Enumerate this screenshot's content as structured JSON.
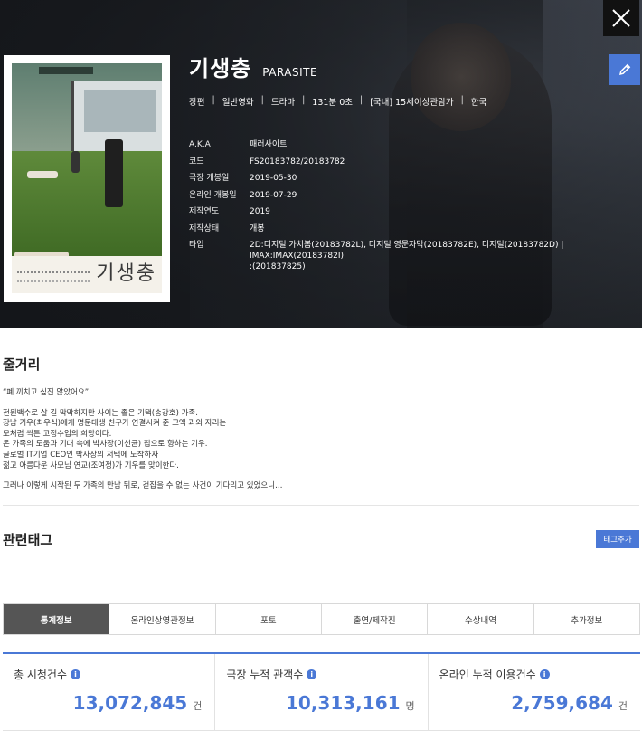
{
  "movie": {
    "title_ko": "기생충",
    "title_en": "PARASITE",
    "meta": [
      "장편",
      "일반영화",
      "드라마",
      "131분 0초",
      "[국내] 15세이상관람가",
      "한국"
    ],
    "specs": [
      {
        "key": "A.K.A",
        "value": "패러사이트"
      },
      {
        "key": "코드",
        "value": "FS20183782/20183782"
      },
      {
        "key": "극장 개봉일",
        "value": "2019-05-30"
      },
      {
        "key": "온라인 개봉일",
        "value": "2019-07-29"
      },
      {
        "key": "제작연도",
        "value": "2019"
      },
      {
        "key": "제작상태",
        "value": "개봉"
      },
      {
        "key": "타입",
        "value": "2D:디지털 가치봄(20183782L), 디지털 영문자막(20183782E), 디지털(20183782D)  |  IMAX:IMAX(20183782I)\n:(201837825)"
      }
    ],
    "poster_title": "기생충"
  },
  "synopsis": {
    "title": "줄거리",
    "paragraphs": [
      "“폐 끼치고 싶진 않았어요”",
      "전원백수로 살 길 막막하지만 사이는 좋은 기택(송강호) 가족.\n장남 기우(최우식)에게 명문대생 친구가 연결시켜 준 고액 과외 자리는\n모처럼 싹튼 고정수입의 희망이다.\n온 가족의 도움과 기대 속에 박사장(이선균) 집으로 향하는 기우.\n글로벌 IT기업 CEO인 박사장의 저택에 도착하자\n젊고 아름다운 사모님 연교(조여정)가 기우를 맞이한다.",
      "그러나 이렇게 시작된 두 가족의 만남 뒤로, 걷잡을 수 없는 사건이 기다리고 있었으니…"
    ]
  },
  "tags": {
    "title": "관련태그",
    "add_label": "태그추가"
  },
  "tabs": [
    "통계정보",
    "온라인상영관정보",
    "포토",
    "출연/제작진",
    "수상내역",
    "추가정보"
  ],
  "active_tab": 0,
  "stats": [
    {
      "label": "총 시청건수",
      "value": "13,072,845",
      "unit": "건"
    },
    {
      "label": "극장 누적 관객수",
      "value": "10,313,161",
      "unit": "명"
    },
    {
      "label": "온라인 누적 이용건수",
      "value": "2,759,684",
      "unit": "건"
    }
  ],
  "colors": {
    "accent": "#4a78d6",
    "active_tab": "#555555"
  },
  "icons": {
    "close": "close-icon",
    "edit": "pencil-icon",
    "info": "info-icon"
  }
}
